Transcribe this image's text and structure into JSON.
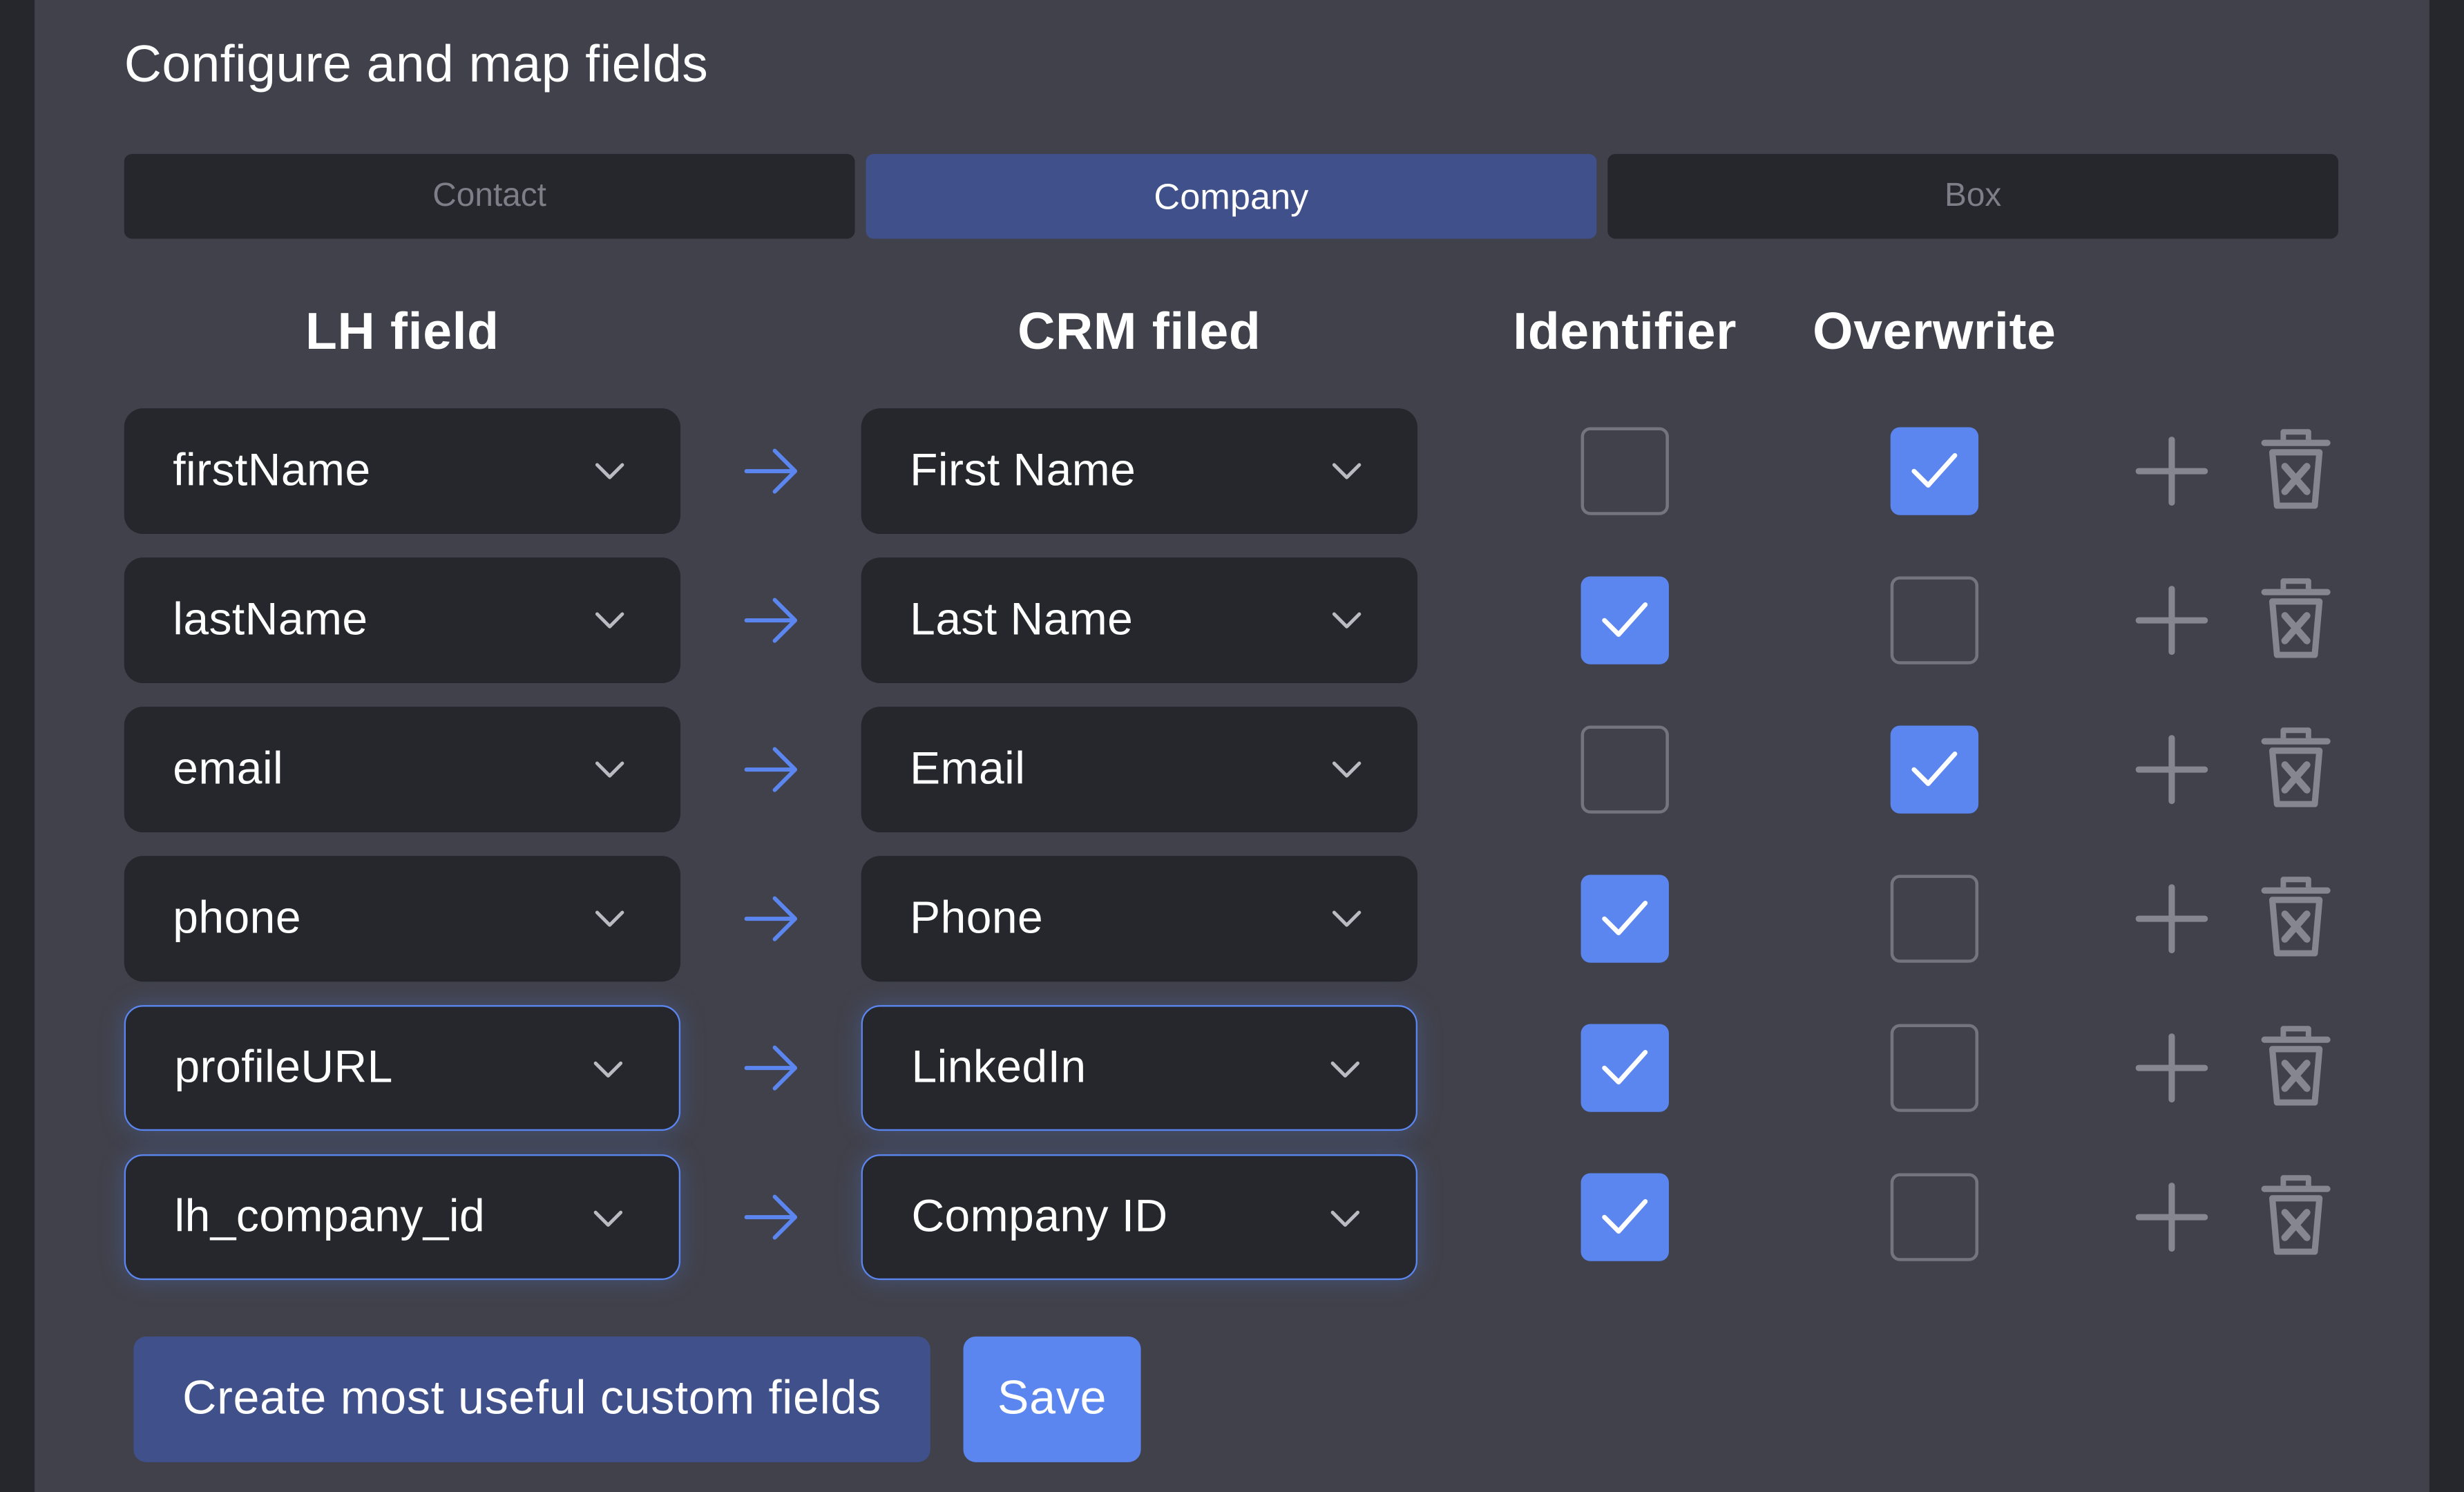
{
  "title": "Configure and map fields",
  "tabs": [
    {
      "label": "Contact",
      "active": false
    },
    {
      "label": "Company",
      "active": true
    },
    {
      "label": "Box",
      "active": false
    }
  ],
  "columns": {
    "lh_field": "LH field",
    "crm_field": "CRM filed",
    "identifier": "Identifier",
    "overwrite": "Overwrite"
  },
  "rows": [
    {
      "lh_field": "firstName",
      "crm_field": "First Name",
      "identifier": false,
      "overwrite": true,
      "focused": false
    },
    {
      "lh_field": "lastName",
      "crm_field": "Last Name",
      "identifier": true,
      "overwrite": false,
      "focused": false
    },
    {
      "lh_field": "email",
      "crm_field": "Email",
      "identifier": false,
      "overwrite": true,
      "focused": false
    },
    {
      "lh_field": "phone",
      "crm_field": "Phone",
      "identifier": true,
      "overwrite": false,
      "focused": false
    },
    {
      "lh_field": "profileURL",
      "crm_field": "LinkedIn",
      "identifier": true,
      "overwrite": false,
      "focused": true
    },
    {
      "lh_field": "lh_company_id",
      "crm_field": "Company ID",
      "identifier": true,
      "overwrite": false,
      "focused": true
    }
  ],
  "footer": {
    "create_fields_label": "Create most useful custom fields",
    "save_label": "Save"
  },
  "icons": {
    "select": "chevron-down-icon",
    "mapping": "arrow-right-icon",
    "checkbox": "check-icon",
    "add": "plus-icon",
    "delete": "trash-icon"
  },
  "colors": {
    "background": "#40414a",
    "surface": "#26272c",
    "accent": "#5b86f0",
    "accent_muted": "#40508a",
    "icon_muted": "#85868f"
  }
}
